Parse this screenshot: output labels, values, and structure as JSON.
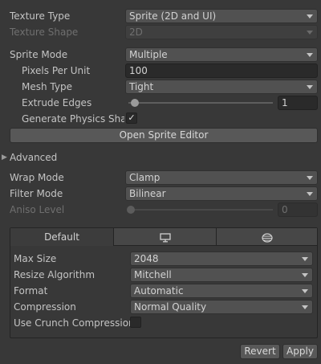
{
  "texture_type": {
    "label": "Texture Type",
    "value": "Sprite (2D and UI)"
  },
  "texture_shape": {
    "label": "Texture Shape",
    "value": "2D"
  },
  "sprite_mode": {
    "label": "Sprite Mode",
    "value": "Multiple"
  },
  "pixels_per_unit": {
    "label": "Pixels Per Unit",
    "value": "100"
  },
  "mesh_type": {
    "label": "Mesh Type",
    "value": "Tight"
  },
  "extrude_edges": {
    "label": "Extrude Edges",
    "value": "1",
    "slider_fraction": 0.03
  },
  "generate_physics_shape": {
    "label": "Generate Physics Shape",
    "checked": true
  },
  "open_sprite_editor": {
    "label": "Open Sprite Editor"
  },
  "advanced": {
    "label": "Advanced"
  },
  "wrap_mode": {
    "label": "Wrap Mode",
    "value": "Clamp"
  },
  "filter_mode": {
    "label": "Filter Mode",
    "value": "Bilinear"
  },
  "aniso_level": {
    "label": "Aniso Level",
    "value": "0",
    "slider_fraction": 0.0
  },
  "platform_tabs": {
    "default_label": "Default",
    "icons": [
      "monitor-icon",
      "web-platform-icon"
    ]
  },
  "platform_settings": {
    "max_size": {
      "label": "Max Size",
      "value": "2048"
    },
    "resize_algorithm": {
      "label": "Resize Algorithm",
      "value": "Mitchell"
    },
    "format": {
      "label": "Format",
      "value": "Automatic"
    },
    "compression": {
      "label": "Compression",
      "value": "Normal Quality"
    },
    "use_crunch_compression": {
      "label": "Use Crunch Compression",
      "checked": false
    }
  },
  "buttons": {
    "revert": "Revert",
    "apply": "Apply"
  },
  "colors": {
    "background": "#383838",
    "dropdown": "#515151",
    "field": "#2a2a2a",
    "text": "#c4c4c4",
    "disabled_text": "#6f6f6f"
  }
}
